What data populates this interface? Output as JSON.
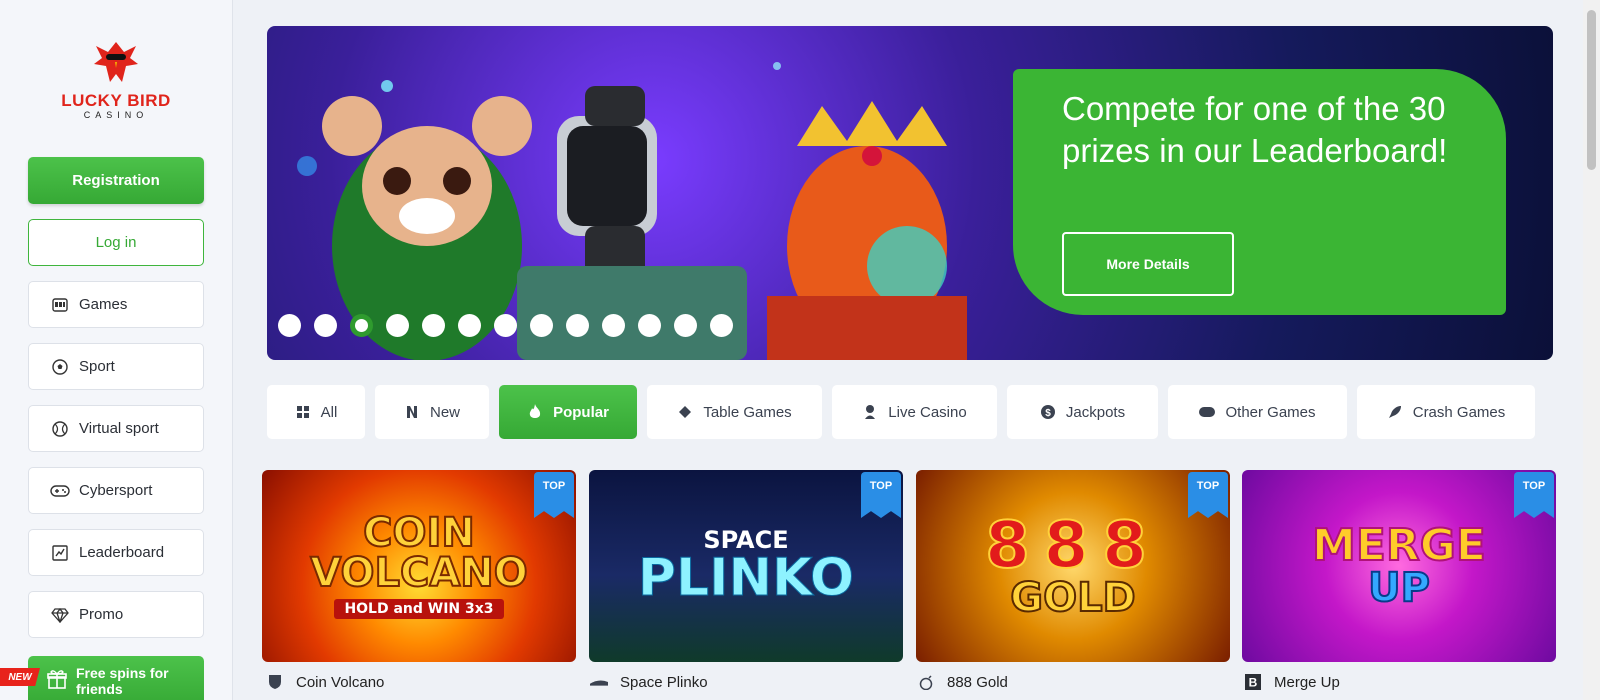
{
  "brand": {
    "name_line1": "LUCKY BIRD",
    "name_line2": "CASINO"
  },
  "auth": {
    "register_label": "Registration",
    "login_label": "Log in"
  },
  "sidebar": {
    "items": [
      {
        "label": "Games",
        "icon": "slot-machine-icon"
      },
      {
        "label": "Sport",
        "icon": "soccer-ball-icon"
      },
      {
        "label": "Virtual sport",
        "icon": "basketball-icon"
      },
      {
        "label": "Cybersport",
        "icon": "gamepad-icon"
      },
      {
        "label": "Leaderboard",
        "icon": "leaderboard-icon"
      },
      {
        "label": "Promo",
        "icon": "diamond-icon"
      }
    ],
    "free_spins_label": "Free spins for friends",
    "new_badge": "NEW"
  },
  "banner": {
    "title": "Compete for one of the 30 prizes in our Leaderboard!",
    "button_label": "More Details",
    "slide_count": 13,
    "active_slide": 3
  },
  "tabs": [
    {
      "label": "All",
      "icon": "grid-icon",
      "active": false
    },
    {
      "label": "New",
      "icon": "new-icon",
      "active": false
    },
    {
      "label": "Popular",
      "icon": "flame-icon",
      "active": true
    },
    {
      "label": "Table Games",
      "icon": "diamond-icon",
      "active": false
    },
    {
      "label": "Live Casino",
      "icon": "person-icon",
      "active": false
    },
    {
      "label": "Jackpots",
      "icon": "dollar-coin-icon",
      "active": false
    },
    {
      "label": "Other Games",
      "icon": "gamepad-icon",
      "active": false
    },
    {
      "label": "Crash Games",
      "icon": "rocket-icon",
      "active": false
    }
  ],
  "games": [
    {
      "name": "Coin Volcano",
      "art_line1": "COIN",
      "art_line2": "VOLCANO",
      "art_line3": "HOLD and WIN 3x3",
      "badge": "TOP",
      "provider_icon": "shield-provider-icon"
    },
    {
      "name": "Space Plinko",
      "art_line1": "SPACE",
      "art_line2": "PLINKO",
      "art_line3": "",
      "badge": "TOP",
      "provider_icon": "wave-provider-icon"
    },
    {
      "name": "888 Gold",
      "art_line1": "888",
      "art_line2": "GOLD",
      "art_line3": "",
      "badge": "TOP",
      "provider_icon": "bomb-provider-icon"
    },
    {
      "name": "Merge Up",
      "art_line1": "MERGE",
      "art_line2": "UP",
      "art_line3": "",
      "badge": "TOP",
      "provider_icon": "b-provider-icon"
    }
  ],
  "colors": {
    "accent_green": "#3bb534",
    "badge_blue": "#2a8ee6",
    "new_red": "#e8231b"
  }
}
